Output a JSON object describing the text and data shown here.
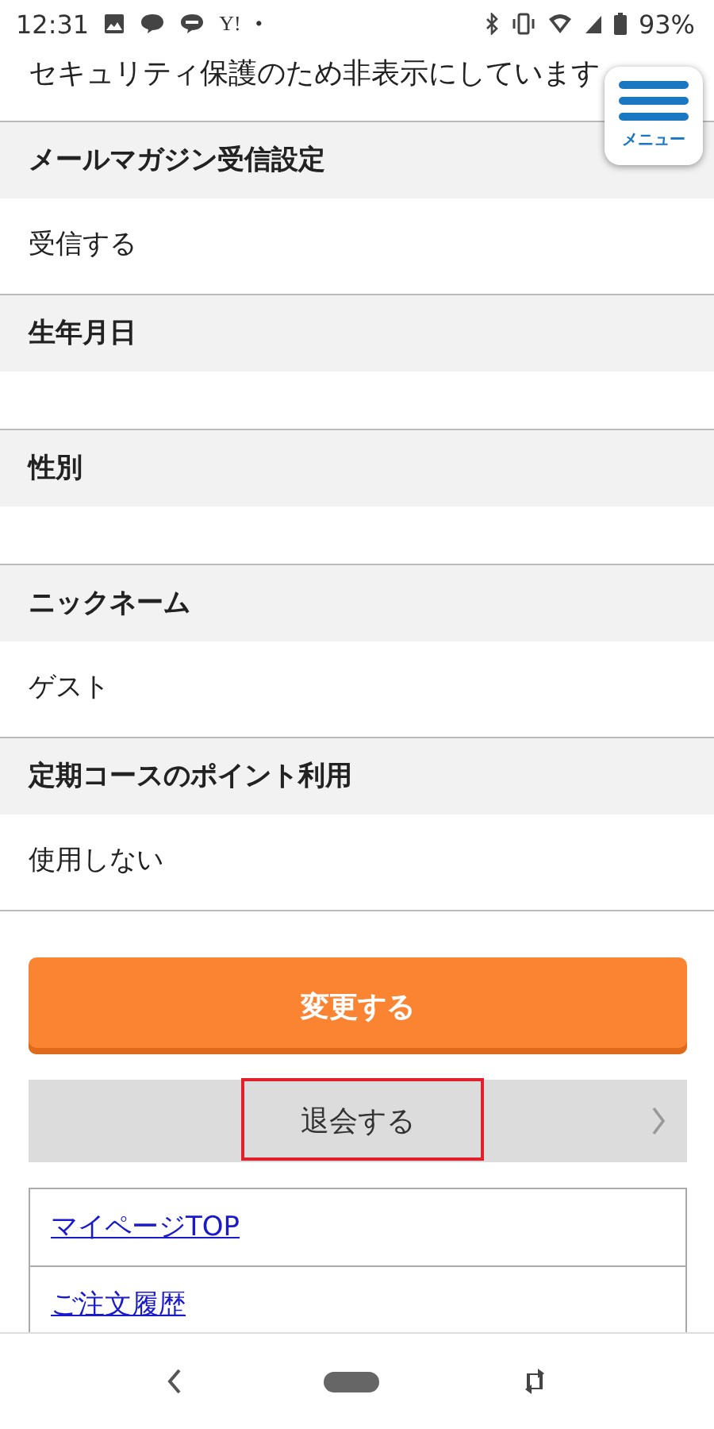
{
  "status_bar": {
    "time": "12:31",
    "notifications": [
      {
        "kind": "image"
      },
      {
        "kind": "chat"
      },
      {
        "kind": "line"
      },
      {
        "kind": "text",
        "text": "Y!"
      },
      {
        "kind": "text",
        "text": "•"
      }
    ],
    "battery": "93%"
  },
  "top_note": "セキュリティ保護のため非表示にしています",
  "menu_button": {
    "label": "メニュー"
  },
  "fields": [
    {
      "label": "メールマガジン受信設定",
      "value": "受信する"
    },
    {
      "label": "生年月日"
    },
    {
      "label": "性別"
    },
    {
      "label": "ニックネーム",
      "value": "ゲスト"
    },
    {
      "label": "定期コースのポイント利用",
      "value": "使用しない"
    }
  ],
  "submit_button": "変更する",
  "withdraw_button": {
    "label": "退会する",
    "highlighted": true
  },
  "links": [
    "マイページTOP",
    "ご注文履歴"
  ]
}
